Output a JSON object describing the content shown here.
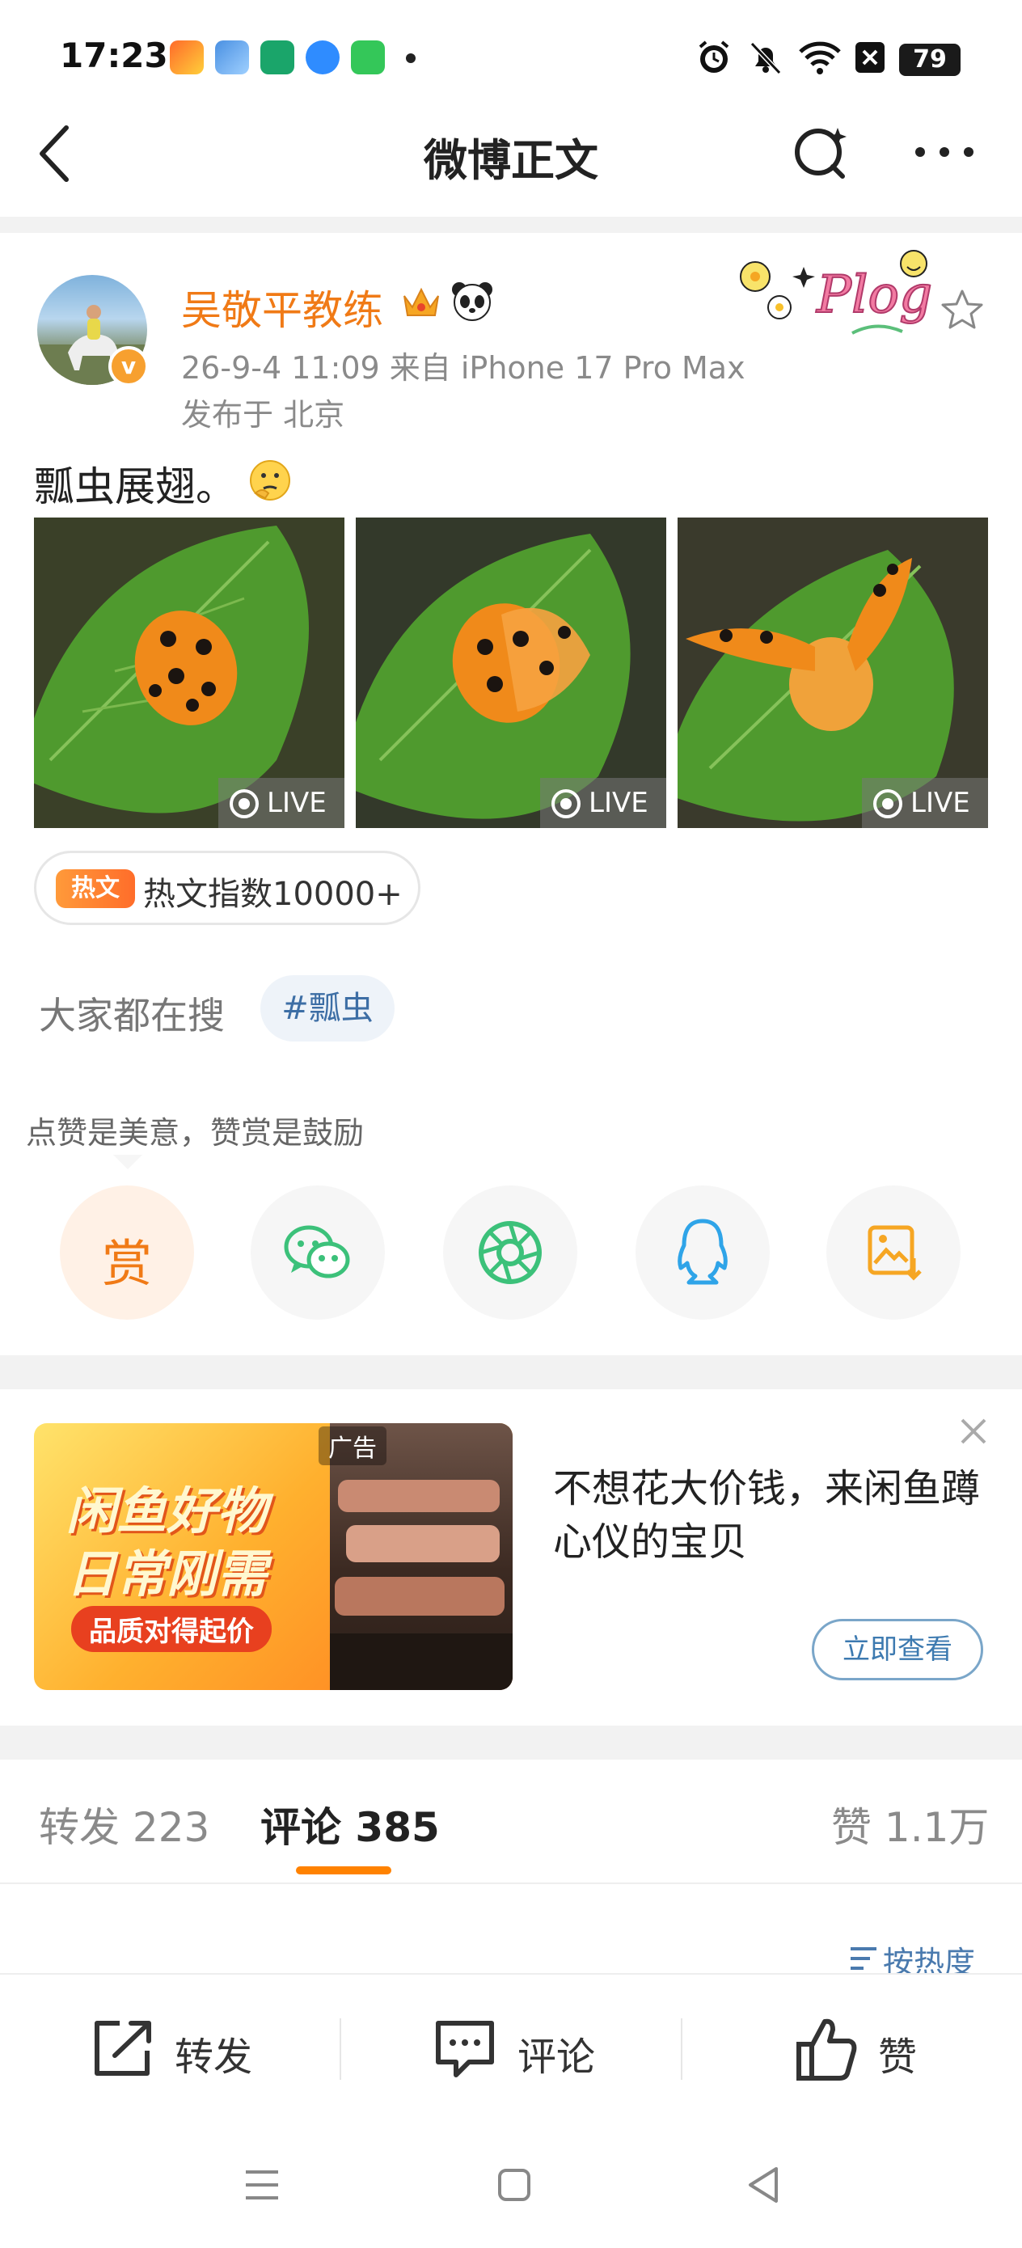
{
  "status_bar": {
    "time": "17:23",
    "battery": "79"
  },
  "header": {
    "title": "微博正文"
  },
  "post": {
    "author": "吴敬平教练",
    "verified_mark": "v",
    "date_device": "26-9-4 11:09   来自 iPhone 17 Pro Max",
    "location": "发布于 北京",
    "text": "瓢虫展翅。",
    "photos": [
      {
        "live_label": "LIVE"
      },
      {
        "live_label": "LIVE"
      },
      {
        "live_label": "LIVE"
      }
    ],
    "hot_badge": "热文",
    "hot_index": "热文指数10000+"
  },
  "search": {
    "label": "大家都在搜",
    "topic": "#瓢虫"
  },
  "share": {
    "tip": "点赞是美意，赞赏是鼓励",
    "reward_label": "赏",
    "icons": [
      "reward-icon",
      "wechat-icon",
      "moments-icon",
      "qq-icon",
      "save-image-icon"
    ]
  },
  "ad": {
    "line1": "闲鱼好物",
    "line2": "日常刚需",
    "line3": "品质对得起价",
    "badge": "广告",
    "text": "不想花大价钱，来闲鱼蹲心仪的宝贝",
    "cta": "立即查看"
  },
  "tabs": {
    "repost": "转发 223",
    "comment": "评论 385",
    "like": "赞 1.1万"
  },
  "sort": "按热度",
  "toolbar": {
    "repost": "转发",
    "comment": "评论",
    "like": "赞"
  },
  "colors": {
    "accent": "#ff8200",
    "name": "#f07a16",
    "link": "#3d6ea5"
  }
}
